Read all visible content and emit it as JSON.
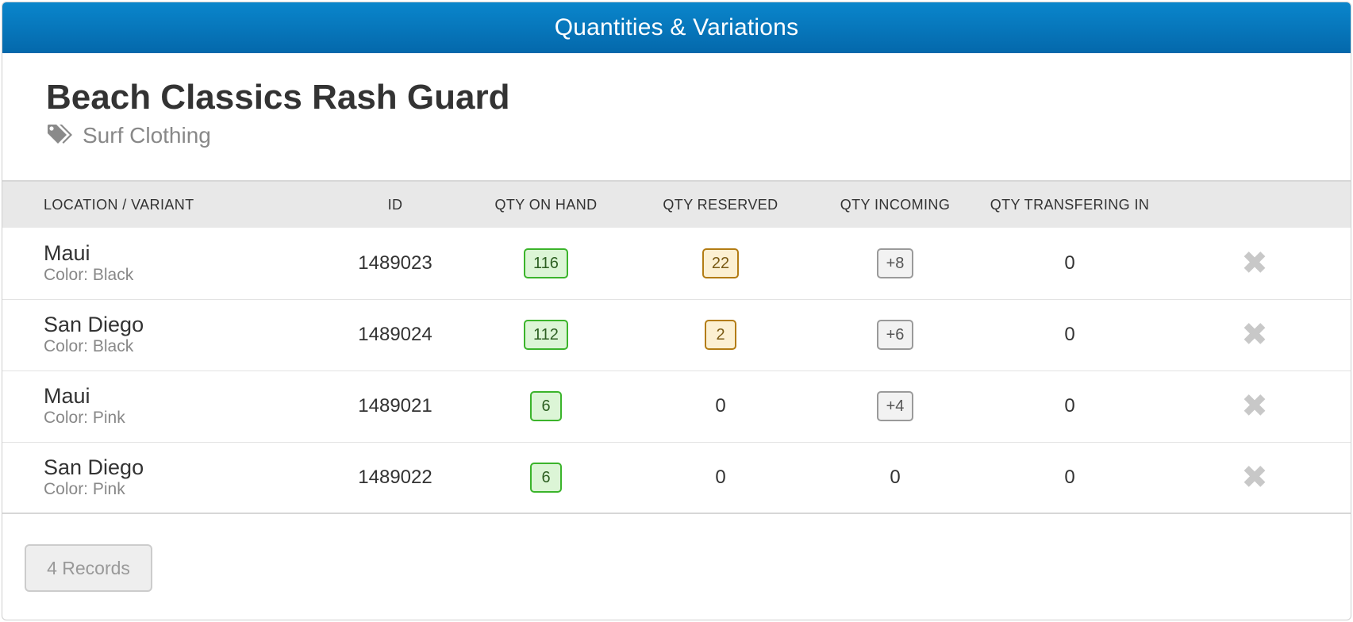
{
  "header": {
    "title": "Quantities & Variations"
  },
  "product": {
    "name": "Beach Classics Rash Guard",
    "category": "Surf Clothing"
  },
  "table": {
    "columns": [
      "LOCATION / VARIANT",
      "ID",
      "QTY ON HAND",
      "QTY RESERVED",
      "QTY INCOMING",
      "QTY TRANSFERING IN"
    ],
    "rows": [
      {
        "location": "Maui",
        "variant": "Color: Black",
        "id": "1489023",
        "on_hand": "116",
        "reserved": "22",
        "incoming": "+8",
        "transfering_in": "0"
      },
      {
        "location": "San Diego",
        "variant": "Color: Black",
        "id": "1489024",
        "on_hand": "112",
        "reserved": "2",
        "incoming": "+6",
        "transfering_in": "0"
      },
      {
        "location": "Maui",
        "variant": "Color: Pink",
        "id": "1489021",
        "on_hand": "6",
        "reserved": "0",
        "incoming": "+4",
        "transfering_in": "0"
      },
      {
        "location": "San Diego",
        "variant": "Color: Pink",
        "id": "1489022",
        "on_hand": "6",
        "reserved": "0",
        "incoming": "0",
        "transfering_in": "0"
      }
    ],
    "delete_icon": "close-icon",
    "badge_colors": {
      "on_hand": "#3bb42b",
      "reserved": "#b37c14",
      "incoming": "#9a9a9a"
    }
  },
  "footer": {
    "records_label": "4 Records"
  },
  "colors": {
    "titlebar": "#0674b8",
    "header_row": "#e8e8e8"
  },
  "icons": {
    "category": "tags-icon"
  }
}
